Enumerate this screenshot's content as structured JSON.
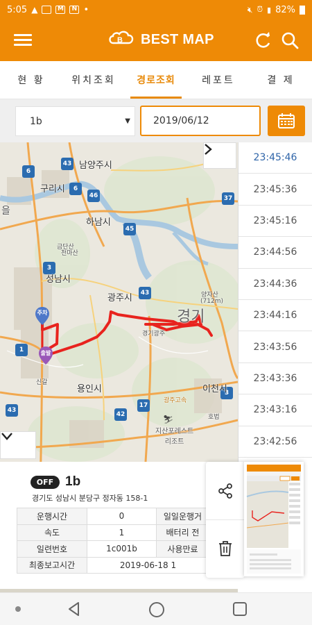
{
  "status_bar": {
    "time": "5:05",
    "battery": "82%"
  },
  "app": {
    "title": "BEST MAP"
  },
  "tabs": [
    {
      "label": "현 황",
      "active": false
    },
    {
      "label": "위치조회",
      "active": false
    },
    {
      "label": "경로조회",
      "active": true
    },
    {
      "label": "레포트",
      "active": false
    },
    {
      "label": "결 제",
      "active": false
    }
  ],
  "filter": {
    "vehicle_selected": "1b",
    "date_value": "2019/06/12"
  },
  "map": {
    "labels": {
      "namyangju": "남양주시",
      "guri": "구리시",
      "hanam": "하남시",
      "seongnam": "성남시",
      "gwangju": "광주시",
      "yongin": "용인시",
      "icheon": "이천시",
      "gyeonggi": "경기",
      "cheonmasan": "천마산",
      "geumdansan": "금단산",
      "yangjasan": "양자산",
      "yangjasan_height": "(712m)",
      "gyeonggi_gwangju": "경기광주",
      "jisan_resort": "지산포레스트\n리조트",
      "hoboek": "호법",
      "singal": "신갈",
      "gwangju_hwy": "광주고속"
    },
    "pins": {
      "start": "출발",
      "end": "주차"
    }
  },
  "time_list": [
    "23:45:46",
    "23:45:36",
    "23:45:16",
    "23:44:56",
    "23:44:36",
    "23:44:16",
    "23:43:56",
    "23:43:36",
    "23:43:16",
    "23:42:56"
  ],
  "vehicle_info": {
    "status_badge": "OFF",
    "name": "1b",
    "address": "경기도 성남시 분당구 정자동 158-1",
    "rows": [
      {
        "label": "운행시간",
        "value": "0",
        "label2": "일일운행거",
        "value2": ""
      },
      {
        "label": "속도",
        "value": "1",
        "label2": "배터리 전",
        "value2": ""
      },
      {
        "label": "일련번호",
        "value": "1c001b",
        "label2": "사용만료",
        "value2": ""
      }
    ],
    "last_report_label": "최종보고시간",
    "last_report_value": "2019-06-18 1"
  },
  "colors": {
    "accent": "#ee8a06",
    "route": "#e8231e",
    "time_first": "#2e64a8"
  },
  "icons": {
    "menu": "hamburger-icon",
    "refresh": "refresh-icon",
    "search": "search-icon",
    "calendar": "calendar-icon",
    "expand": "chevron-right-icon",
    "collapse": "chevron-down-icon",
    "share": "share-icon",
    "delete": "trash-icon"
  }
}
